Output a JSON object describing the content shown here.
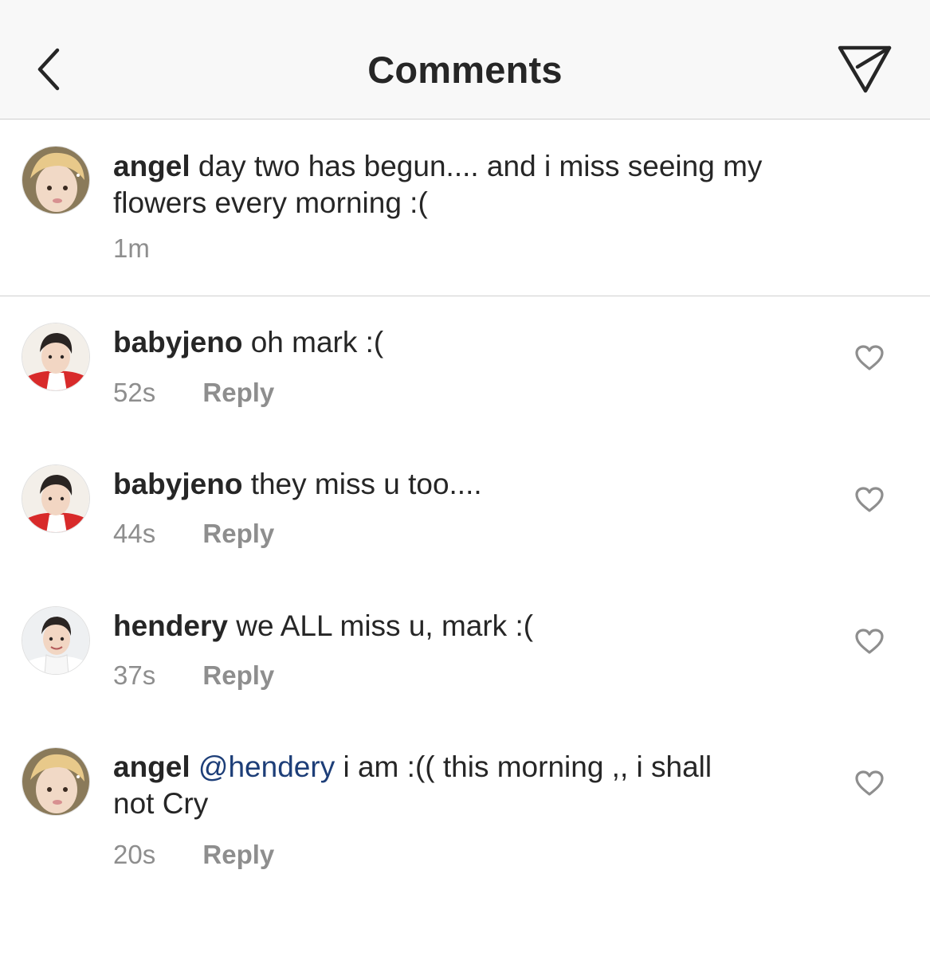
{
  "header": {
    "title": "Comments",
    "back_icon": "chevron-left-icon",
    "send_icon": "paper-plane-icon"
  },
  "caption": {
    "username": "angel",
    "text": "day two has begun.... and i miss seeing my",
    "text_line2": "flowers every morning :(",
    "time": "1m"
  },
  "comments": [
    {
      "username": "babyjeno",
      "mention": "",
      "text": "oh mark :(",
      "text_line2": "",
      "time": "52s",
      "reply_label": "Reply"
    },
    {
      "username": "babyjeno",
      "mention": "",
      "text": "they miss u too....",
      "text_line2": "",
      "time": "44s",
      "reply_label": "Reply"
    },
    {
      "username": "hendery",
      "mention": "",
      "text": "we ALL miss u, mark :(",
      "text_line2": "",
      "time": "37s",
      "reply_label": "Reply"
    },
    {
      "username": "angel",
      "mention": "@hendery",
      "text": "i am :(( this morning ,, i shall",
      "text_line2": "not Cry",
      "time": "20s",
      "reply_label": "Reply"
    }
  ],
  "colors": {
    "text": "#262626",
    "meta": "#8e8e8e",
    "mention": "#1d3e78",
    "header_bg": "#f8f8f8"
  }
}
